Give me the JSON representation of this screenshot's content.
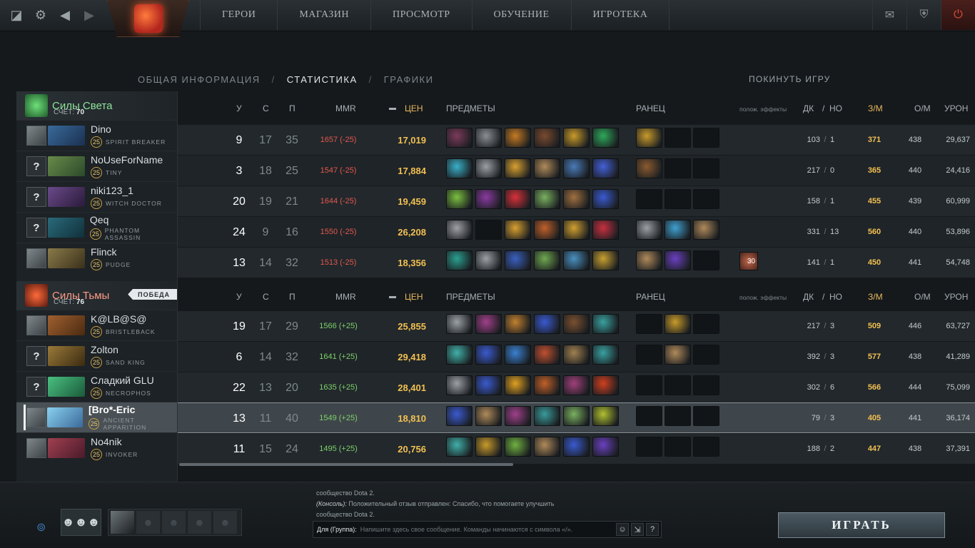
{
  "nav": {
    "items": [
      "ГЕРОИ",
      "МАГАЗИН",
      "ПРОСМОТР",
      "ОБУЧЕНИЕ",
      "ИГРОТЕКА"
    ]
  },
  "tabs": {
    "overview": "ОБЩАЯ ИНФОРМАЦИЯ",
    "sep": "/",
    "stats": "СТАТИСТИКА",
    "graphs": "ГРАФИКИ",
    "leave": "ПОКИНУТЬ ИГРУ"
  },
  "columns": {
    "k": "У",
    "d": "С",
    "a": "П",
    "mmr": "MMR",
    "networth": "ЦЕН",
    "items": "ПРЕДМЕТЫ",
    "backpack": "РАНЕЦ",
    "buffs": "полож. эффекты",
    "lh": "ДК",
    "slash": "/",
    "dn": "НО",
    "gpm": "З/М",
    "xpm": "О/М",
    "damage": "УРОН"
  },
  "radiant": {
    "name": "Силы Света",
    "score_label": "СЧЕТ:",
    "score": "70",
    "players": [
      {
        "name": "Dino",
        "level": "25",
        "hero": "SPIRIT BREAKER",
        "avatar": "",
        "k": "9",
        "d": "17",
        "a": "35",
        "mmr": "1657 (-25)",
        "networth": "17,019",
        "lh": "103",
        "dn": "1",
        "gpm": "371",
        "xpm": "438",
        "damage": "29,637"
      },
      {
        "name": "NoUseForName",
        "level": "25",
        "hero": "TINY",
        "avatar": "?",
        "k": "3",
        "d": "18",
        "a": "25",
        "mmr": "1547 (-25)",
        "networth": "17,884",
        "lh": "217",
        "dn": "0",
        "gpm": "365",
        "xpm": "440",
        "damage": "24,416"
      },
      {
        "name": "niki123_1",
        "level": "25",
        "hero": "WITCH DOCTOR",
        "avatar": "?",
        "k": "20",
        "d": "19",
        "a": "21",
        "mmr": "1644 (-25)",
        "networth": "19,459",
        "lh": "158",
        "dn": "1",
        "gpm": "455",
        "xpm": "439",
        "damage": "60,999"
      },
      {
        "name": "Qeq",
        "level": "25",
        "hero": "PHANTOM ASSASSIN",
        "avatar": "?",
        "k": "24",
        "d": "9",
        "a": "16",
        "mmr": "1550 (-25)",
        "networth": "26,208",
        "lh": "331",
        "dn": "13",
        "gpm": "560",
        "xpm": "440",
        "damage": "53,896"
      },
      {
        "name": "Flinck",
        "level": "25",
        "hero": "PUDGE",
        "avatar": "",
        "k": "13",
        "d": "14",
        "a": "32",
        "mmr": "1513 (-25)",
        "networth": "18,356",
        "lh": "141",
        "dn": "1",
        "gpm": "450",
        "xpm": "441",
        "damage": "54,748",
        "buff_count": "30"
      }
    ]
  },
  "dire": {
    "name": "Силы Тьмы",
    "score_label": "СЧЕТ:",
    "score": "76",
    "victory": "ПОБЕДА",
    "players": [
      {
        "name": "K@LB@S@",
        "level": "25",
        "hero": "BRISTLEBACK",
        "avatar": "",
        "k": "19",
        "d": "17",
        "a": "29",
        "mmr": "1566 (+25)",
        "networth": "25,855",
        "lh": "217",
        "dn": "3",
        "gpm": "509",
        "xpm": "446",
        "damage": "63,727"
      },
      {
        "name": "Zolton",
        "level": "25",
        "hero": "SAND KING",
        "avatar": "?",
        "k": "6",
        "d": "14",
        "a": "32",
        "mmr": "1641 (+25)",
        "networth": "29,418",
        "lh": "392",
        "dn": "3",
        "gpm": "577",
        "xpm": "438",
        "damage": "41,289"
      },
      {
        "name": "Сладкий GLU",
        "level": "25",
        "hero": "NECROPHOS",
        "avatar": "?",
        "k": "22",
        "d": "13",
        "a": "20",
        "mmr": "1635 (+25)",
        "networth": "28,401",
        "lh": "302",
        "dn": "6",
        "gpm": "566",
        "xpm": "444",
        "damage": "75,099"
      },
      {
        "name": "[Bro*-Eric",
        "level": "25",
        "hero": "ANCIENT APPARITION",
        "avatar": "",
        "k": "13",
        "d": "11",
        "a": "40",
        "mmr": "1549 (+25)",
        "networth": "18,810",
        "lh": "79",
        "dn": "3",
        "gpm": "405",
        "xpm": "441",
        "damage": "36,174"
      },
      {
        "name": "No4nik",
        "level": "25",
        "hero": "INVOKER",
        "avatar": "",
        "k": "11",
        "d": "15",
        "a": "24",
        "mmr": "1495 (+25)",
        "networth": "20,756",
        "lh": "188",
        "dn": "2",
        "gpm": "447",
        "xpm": "438",
        "damage": "37,391"
      }
    ]
  },
  "chat": {
    "line1": "сообщество Dota 2.",
    "line2_prefix": "(Консоль):",
    "line2": " Положительный отзыв отправлен: Спасибо, что помогаете улучшить",
    "line3": "сообщество Dota 2.",
    "to": "Для (Группа):",
    "placeholder": "Напишите здесь свое сообщение. Команды начинаются с символа «/».",
    "help": "?"
  },
  "play_label": "ИГРАТЬ",
  "colors": {
    "accent_gold": "#f2c052",
    "radiant": "#8fe39a",
    "dire": "#ff9b86",
    "mmr_loss": "#e3584d",
    "mmr_gain": "#7ed06a"
  },
  "item_colors": {
    "r0": [
      "#7c3a5a",
      "#8a8f94",
      "#c47a22",
      "#7a4a2e",
      "#c89a2a",
      "#2fa85a"
    ],
    "r1": [
      "#3ab0c8",
      "#9aa0a6",
      "#d8a030",
      "#b08a5a",
      "#4a7ab8",
      "#4460d8"
    ],
    "r2": [
      "#7ac040",
      "#8a3aa0",
      "#d8303a",
      "#7ab060",
      "#a07040",
      "#3a5ad0"
    ],
    "r3": [
      "#a0a0a8",
      "#121517",
      "#d8a030",
      "#c0602a",
      "#d0a030",
      "#c83040"
    ],
    "r4": [
      "#2aa090",
      "#9aa0a6",
      "#3a60c0",
      "#70a850",
      "#4a90c0",
      "#c8a030"
    ],
    "r5": [
      "#9aa0a6",
      "#a0408a",
      "#c08030",
      "#3a5ad0",
      "#7a5030",
      "#3aa0a0"
    ],
    "r6": [
      "#40b0a8",
      "#3a5ad0",
      "#3a80d0",
      "#c05030",
      "#a08050",
      "#3aa0a0"
    ],
    "r7": [
      "#9aa0a6",
      "#3a5ad0",
      "#e0a020",
      "#c06028",
      "#a0407a",
      "#d04020"
    ],
    "r8": [
      "#3a5ad0",
      "#b08a5a",
      "#a0408a",
      "#3a9a9a",
      "#7ab060",
      "#b0c030"
    ],
    "r9": [
      "#40b0a8",
      "#c89a2a",
      "#70b040",
      "#b08a5a",
      "#3a5ad0",
      "#6a40c0"
    ]
  },
  "bp_colors": {
    "r0": [
      "#c89a2a",
      "#121517",
      "#121517"
    ],
    "r1": [
      "#8a5a30",
      "#121517",
      "#121517"
    ],
    "r2": [
      "#121517",
      "#121517",
      "#121517"
    ],
    "r3": [
      "#9aa0a6",
      "#40a0d0",
      "#b08a5a"
    ],
    "r4": [
      "#b08a5a",
      "#6a40c0",
      "#121517"
    ],
    "r5": [
      "#121517",
      "#c89a2a",
      "#121517"
    ],
    "r6": [
      "#121517",
      "#b08a5a",
      "#121517"
    ],
    "r7": [
      "#121517",
      "#121517",
      "#121517"
    ],
    "r8": [
      "#121517",
      "#121517",
      "#121517"
    ],
    "r9": [
      "#121517",
      "#121517",
      "#121517"
    ]
  },
  "hero_colors": {
    "r0": [
      "#3a6a9a",
      "#1a3050"
    ],
    "r1": [
      "#6a8a4a",
      "#2a4a2a"
    ],
    "r2": [
      "#6a4a8a",
      "#2a1a3a"
    ],
    "r3": [
      "#2a6a7a",
      "#10303a"
    ],
    "r4": [
      "#8a7a4a",
      "#3a301a"
    ],
    "r5": [
      "#a06030",
      "#4a2a10"
    ],
    "r6": [
      "#9a7a3a",
      "#3a2a10"
    ],
    "r7": [
      "#4ac080",
      "#1a5a3a"
    ],
    "r8": [
      "#8ad0f0",
      "#3a6a9a"
    ],
    "r9": [
      "#a04050",
      "#4a1a2a"
    ]
  }
}
